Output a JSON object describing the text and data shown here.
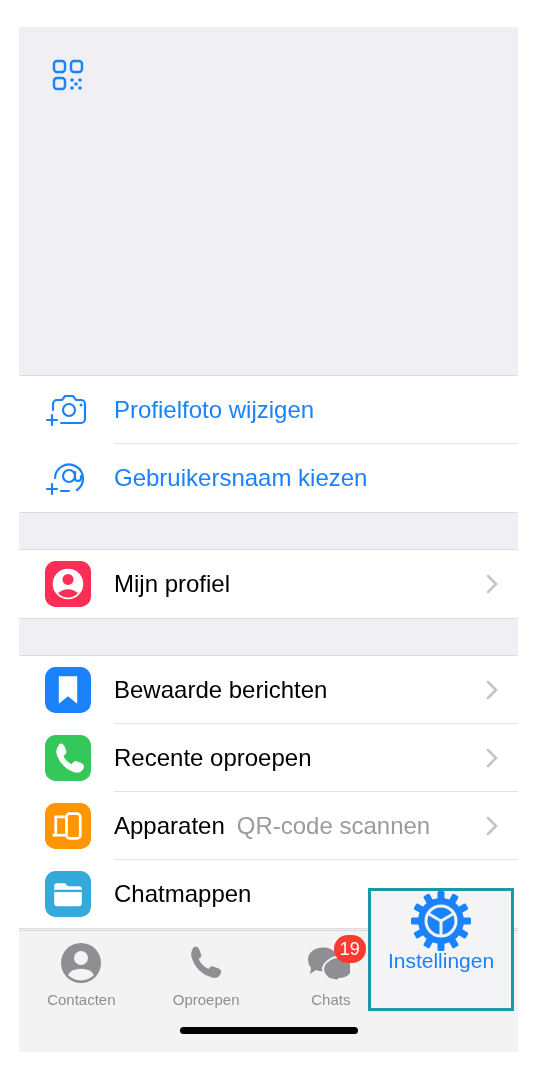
{
  "sections": [
    {
      "rows": [
        {
          "kind": "action",
          "label": "Profielfoto wijzigen"
        },
        {
          "kind": "action",
          "label": "Gebruikersnaam kiezen"
        }
      ]
    },
    {
      "rows": [
        {
          "kind": "nav",
          "color": "#fe2d55",
          "label": "Mijn profiel",
          "chevron": true
        }
      ]
    },
    {
      "rows": [
        {
          "kind": "nav",
          "color": "#1a82fb",
          "label": "Bewaarde berichten",
          "chevron": true
        },
        {
          "kind": "nav",
          "color": "#34c759",
          "label": "Recente oproepen",
          "chevron": true
        },
        {
          "kind": "nav",
          "color": "#ff9500",
          "label": "Apparaten",
          "detail": "QR-code scannen",
          "chevron": true
        },
        {
          "kind": "nav",
          "color": "#34aadc",
          "label": "Chatmappen",
          "chevron": false
        }
      ]
    }
  ],
  "tabs": [
    {
      "label": "Contacten",
      "selected": false
    },
    {
      "label": "Oproepen",
      "selected": false
    },
    {
      "label": "Chats",
      "badge": "19",
      "selected": false
    },
    {
      "label": "Instellingen",
      "selected": true
    }
  ]
}
